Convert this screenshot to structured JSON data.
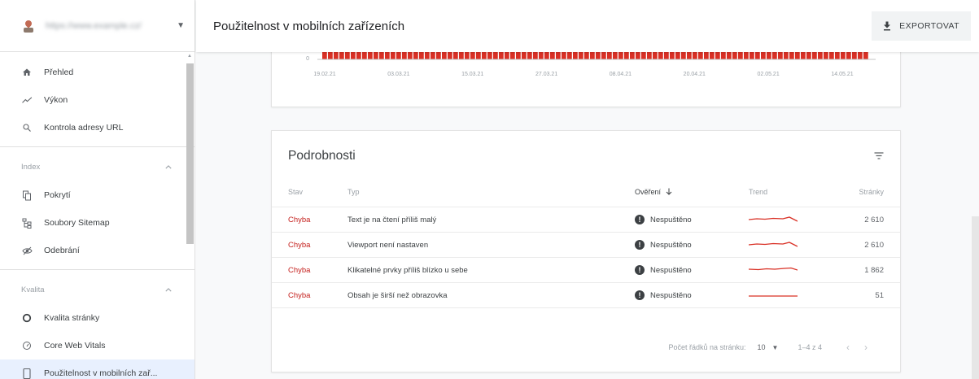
{
  "sidebar": {
    "property_url": "https://www.example.cz/",
    "nav_top": [
      {
        "label": "Přehled",
        "icon": "home-icon"
      },
      {
        "label": "Výkon",
        "icon": "trending-icon"
      },
      {
        "label": "Kontrola adresy URL",
        "icon": "search-icon"
      }
    ],
    "section_index": "Index",
    "nav_index": [
      {
        "label": "Pokrytí",
        "icon": "copy-icon"
      },
      {
        "label": "Soubory Sitemap",
        "icon": "sitemap-icon"
      },
      {
        "label": "Odebrání",
        "icon": "eye-off-icon"
      }
    ],
    "section_quality": "Kvalita",
    "nav_quality": [
      {
        "label": "Kvalita stránky",
        "icon": "circle-icon"
      },
      {
        "label": "Core Web Vitals",
        "icon": "gauge-icon"
      },
      {
        "label": "Použitelnost v mobilních zař...",
        "icon": "phone-icon"
      }
    ]
  },
  "header": {
    "title": "Použitelnost v mobilních zařízeních",
    "export_label": "EXPORTOVAT"
  },
  "chart_data": {
    "type": "bar",
    "y_tick_label": "0",
    "x_tick_labels": [
      "19.02.21",
      "03.03.21",
      "15.03.21",
      "27.03.21",
      "08.04.21",
      "20.04.21",
      "02.05.21",
      "14.05.21"
    ],
    "bar_color": "#d93025",
    "bar_count": 96
  },
  "details": {
    "title": "Podrobnosti",
    "columns": {
      "stav": "Stav",
      "typ": "Typ",
      "overeni": "Ověření",
      "trend": "Trend",
      "stranky": "Stránky"
    },
    "rows": [
      {
        "stav": "Chyba",
        "typ": "Text je na čtení příliš malý",
        "overeni": "Nespuštěno",
        "stranky": "2 610"
      },
      {
        "stav": "Chyba",
        "typ": "Viewport není nastaven",
        "overeni": "Nespuštěno",
        "stranky": "2 610"
      },
      {
        "stav": "Chyba",
        "typ": "Klikatelné prvky příliš blízko u sebe",
        "overeni": "Nespuštěno",
        "stranky": "1 862"
      },
      {
        "stav": "Chyba",
        "typ": "Obsah je širší než obrazovka",
        "overeni": "Nespuštěno",
        "stranky": "51"
      }
    ],
    "footer": {
      "rows_per_page_label": "Počet řádků na stránku:",
      "rows_per_page": "10",
      "range": "1–4 z 4"
    }
  }
}
